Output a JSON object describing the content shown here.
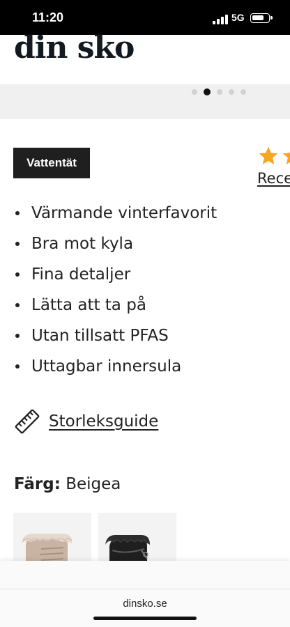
{
  "status_bar": {
    "time": "11:20",
    "network": "5G"
  },
  "header": {
    "logo": "din sko"
  },
  "gallery": {
    "dot_count": 5,
    "active_index": 1
  },
  "badge": {
    "label": "Vattentät"
  },
  "rating": {
    "link_label": "Rece",
    "star_color": "#f5a623"
  },
  "features": [
    "Värmande vinterfavorit",
    "Bra mot kyla",
    "Fina detaljer",
    "Lätta att ta på",
    "Utan tillsatt PFAS",
    "Uttagbar innersula"
  ],
  "size_guide": {
    "label": "Storleksguide",
    "icon": "ruler-icon"
  },
  "color": {
    "label": "Färg:",
    "value": "Beigea"
  },
  "color_options": [
    "beige-boot",
    "black-boot"
  ],
  "browser": {
    "url": "dinsko.se"
  }
}
